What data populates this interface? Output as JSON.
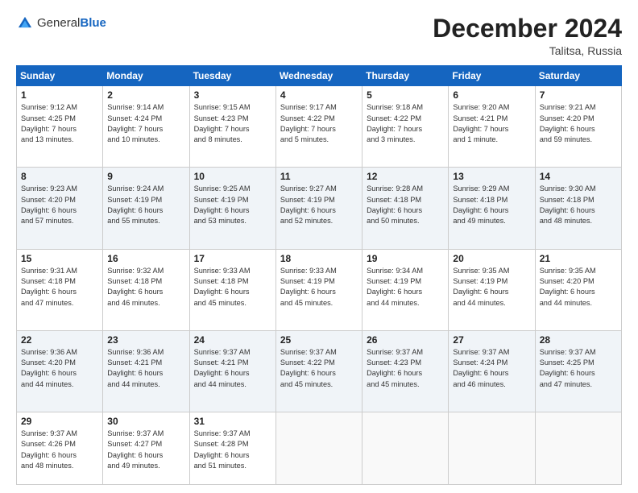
{
  "logo": {
    "general": "General",
    "blue": "Blue"
  },
  "header": {
    "month": "December 2024",
    "location": "Talitsa, Russia"
  },
  "days_of_week": [
    "Sunday",
    "Monday",
    "Tuesday",
    "Wednesday",
    "Thursday",
    "Friday",
    "Saturday"
  ],
  "weeks": [
    [
      {
        "day": "1",
        "info": "Sunrise: 9:12 AM\nSunset: 4:25 PM\nDaylight: 7 hours\nand 13 minutes."
      },
      {
        "day": "2",
        "info": "Sunrise: 9:14 AM\nSunset: 4:24 PM\nDaylight: 7 hours\nand 10 minutes."
      },
      {
        "day": "3",
        "info": "Sunrise: 9:15 AM\nSunset: 4:23 PM\nDaylight: 7 hours\nand 8 minutes."
      },
      {
        "day": "4",
        "info": "Sunrise: 9:17 AM\nSunset: 4:22 PM\nDaylight: 7 hours\nand 5 minutes."
      },
      {
        "day": "5",
        "info": "Sunrise: 9:18 AM\nSunset: 4:22 PM\nDaylight: 7 hours\nand 3 minutes."
      },
      {
        "day": "6",
        "info": "Sunrise: 9:20 AM\nSunset: 4:21 PM\nDaylight: 7 hours\nand 1 minute."
      },
      {
        "day": "7",
        "info": "Sunrise: 9:21 AM\nSunset: 4:20 PM\nDaylight: 6 hours\nand 59 minutes."
      }
    ],
    [
      {
        "day": "8",
        "info": "Sunrise: 9:23 AM\nSunset: 4:20 PM\nDaylight: 6 hours\nand 57 minutes."
      },
      {
        "day": "9",
        "info": "Sunrise: 9:24 AM\nSunset: 4:19 PM\nDaylight: 6 hours\nand 55 minutes."
      },
      {
        "day": "10",
        "info": "Sunrise: 9:25 AM\nSunset: 4:19 PM\nDaylight: 6 hours\nand 53 minutes."
      },
      {
        "day": "11",
        "info": "Sunrise: 9:27 AM\nSunset: 4:19 PM\nDaylight: 6 hours\nand 52 minutes."
      },
      {
        "day": "12",
        "info": "Sunrise: 9:28 AM\nSunset: 4:18 PM\nDaylight: 6 hours\nand 50 minutes."
      },
      {
        "day": "13",
        "info": "Sunrise: 9:29 AM\nSunset: 4:18 PM\nDaylight: 6 hours\nand 49 minutes."
      },
      {
        "day": "14",
        "info": "Sunrise: 9:30 AM\nSunset: 4:18 PM\nDaylight: 6 hours\nand 48 minutes."
      }
    ],
    [
      {
        "day": "15",
        "info": "Sunrise: 9:31 AM\nSunset: 4:18 PM\nDaylight: 6 hours\nand 47 minutes."
      },
      {
        "day": "16",
        "info": "Sunrise: 9:32 AM\nSunset: 4:18 PM\nDaylight: 6 hours\nand 46 minutes."
      },
      {
        "day": "17",
        "info": "Sunrise: 9:33 AM\nSunset: 4:18 PM\nDaylight: 6 hours\nand 45 minutes."
      },
      {
        "day": "18",
        "info": "Sunrise: 9:33 AM\nSunset: 4:19 PM\nDaylight: 6 hours\nand 45 minutes."
      },
      {
        "day": "19",
        "info": "Sunrise: 9:34 AM\nSunset: 4:19 PM\nDaylight: 6 hours\nand 44 minutes."
      },
      {
        "day": "20",
        "info": "Sunrise: 9:35 AM\nSunset: 4:19 PM\nDaylight: 6 hours\nand 44 minutes."
      },
      {
        "day": "21",
        "info": "Sunrise: 9:35 AM\nSunset: 4:20 PM\nDaylight: 6 hours\nand 44 minutes."
      }
    ],
    [
      {
        "day": "22",
        "info": "Sunrise: 9:36 AM\nSunset: 4:20 PM\nDaylight: 6 hours\nand 44 minutes."
      },
      {
        "day": "23",
        "info": "Sunrise: 9:36 AM\nSunset: 4:21 PM\nDaylight: 6 hours\nand 44 minutes."
      },
      {
        "day": "24",
        "info": "Sunrise: 9:37 AM\nSunset: 4:21 PM\nDaylight: 6 hours\nand 44 minutes."
      },
      {
        "day": "25",
        "info": "Sunrise: 9:37 AM\nSunset: 4:22 PM\nDaylight: 6 hours\nand 45 minutes."
      },
      {
        "day": "26",
        "info": "Sunrise: 9:37 AM\nSunset: 4:23 PM\nDaylight: 6 hours\nand 45 minutes."
      },
      {
        "day": "27",
        "info": "Sunrise: 9:37 AM\nSunset: 4:24 PM\nDaylight: 6 hours\nand 46 minutes."
      },
      {
        "day": "28",
        "info": "Sunrise: 9:37 AM\nSunset: 4:25 PM\nDaylight: 6 hours\nand 47 minutes."
      }
    ],
    [
      {
        "day": "29",
        "info": "Sunrise: 9:37 AM\nSunset: 4:26 PM\nDaylight: 6 hours\nand 48 minutes."
      },
      {
        "day": "30",
        "info": "Sunrise: 9:37 AM\nSunset: 4:27 PM\nDaylight: 6 hours\nand 49 minutes."
      },
      {
        "day": "31",
        "info": "Sunrise: 9:37 AM\nSunset: 4:28 PM\nDaylight: 6 hours\nand 51 minutes."
      },
      {
        "day": "",
        "info": ""
      },
      {
        "day": "",
        "info": ""
      },
      {
        "day": "",
        "info": ""
      },
      {
        "day": "",
        "info": ""
      }
    ]
  ]
}
